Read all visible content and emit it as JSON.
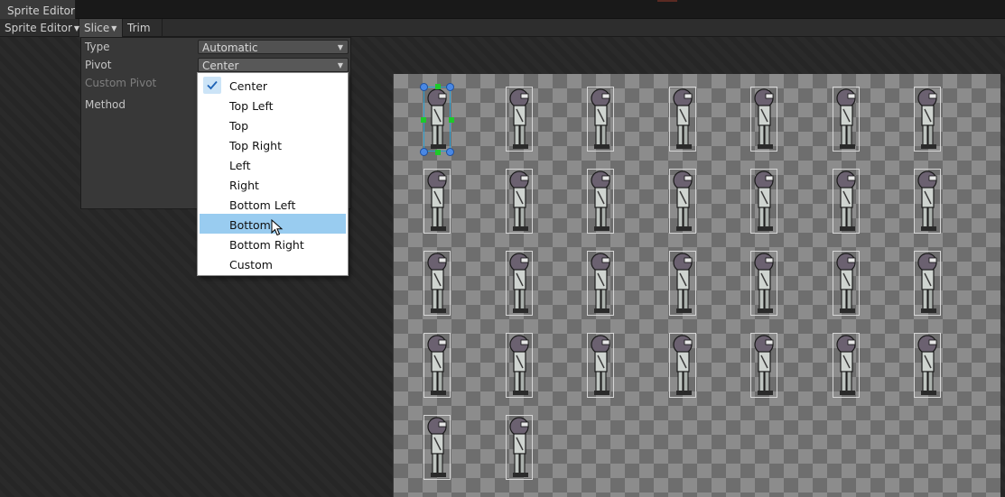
{
  "window": {
    "tab_title": "Sprite Editor"
  },
  "toolbar": {
    "sprite_editor_label": "Sprite Editor",
    "slice_label": "Slice",
    "trim_label": "Trim"
  },
  "slice_panel": {
    "type_label": "Type",
    "type_value": "Automatic",
    "pivot_label": "Pivot",
    "pivot_value": "Center",
    "custom_pivot_label": "Custom Pivot",
    "method_label": "Method"
  },
  "pivot_dropdown": {
    "options": [
      "Center",
      "Top Left",
      "Top",
      "Top Right",
      "Left",
      "Right",
      "Bottom Left",
      "Bottom",
      "Bottom Right",
      "Custom"
    ],
    "checked": "Center",
    "hovered": "Bottom"
  },
  "sprite_sheet": {
    "rows": [
      7,
      7,
      7,
      7,
      2
    ],
    "selected_index": 0
  },
  "colors": {
    "highlight": "#99ccf0",
    "selection_handle": "#4a88e4",
    "edge_handle": "#1ec82a"
  }
}
